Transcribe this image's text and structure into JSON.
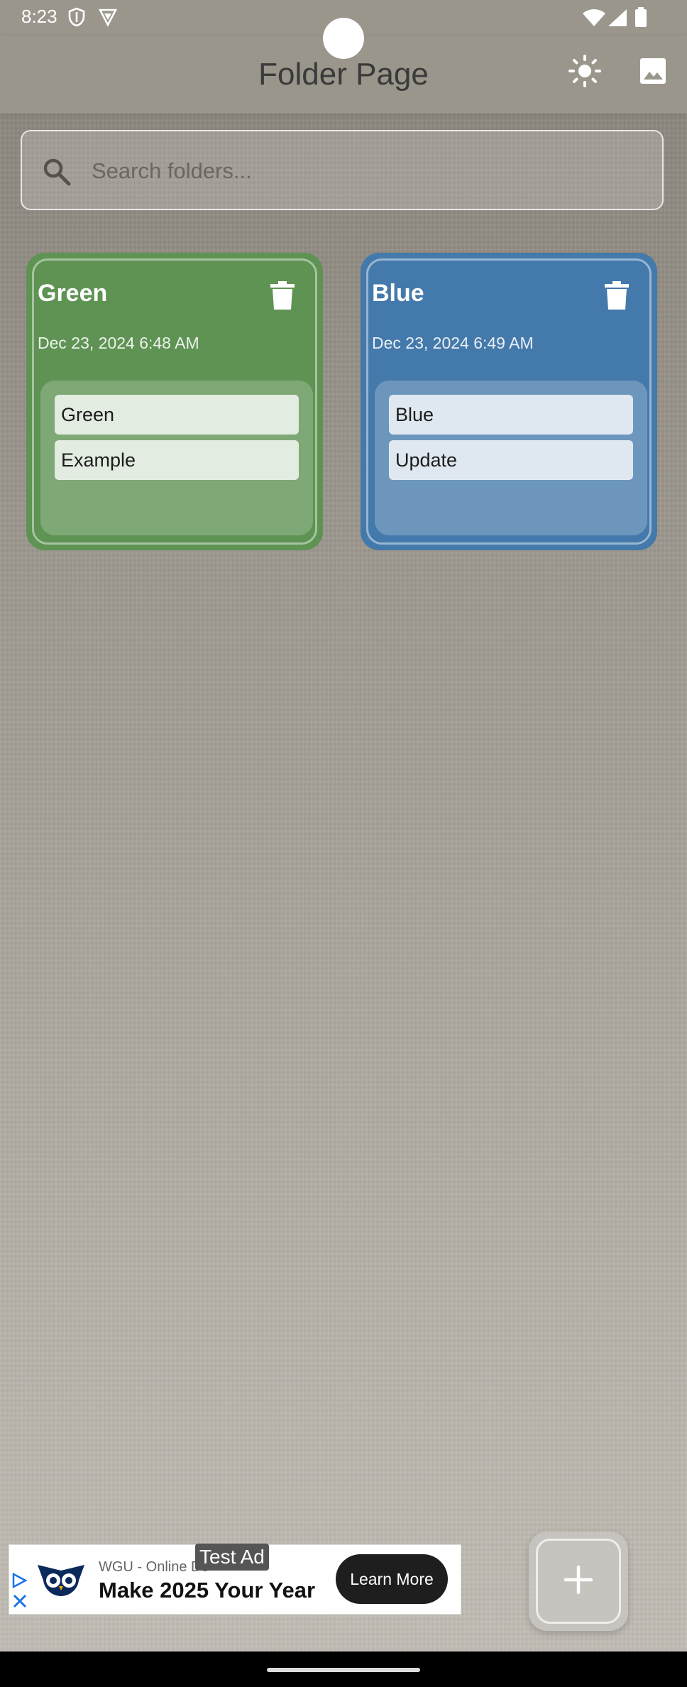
{
  "status_bar": {
    "time": "8:23",
    "left_icons": [
      "shield-icon",
      "vpn-icon"
    ],
    "right_icons": [
      "wifi-icon",
      "cell-signal-icon",
      "battery-icon"
    ]
  },
  "app_bar": {
    "title": "Folder Page",
    "actions": [
      "brightness-icon",
      "image-icon"
    ]
  },
  "search": {
    "placeholder": "Search folders..."
  },
  "folders": [
    {
      "title": "Green",
      "date": "Dec 23, 2024 6:48 AM",
      "color": "#5e9353",
      "notes": [
        "Green",
        "Example"
      ]
    },
    {
      "title": "Blue",
      "date": "Dec 23, 2024 6:49 AM",
      "color": "#4479ab",
      "notes": [
        "Blue",
        "Update"
      ]
    }
  ],
  "ad": {
    "tag": "Test Ad",
    "source": "WGU - Online De",
    "headline": "Make 2025 Your Year",
    "cta": "Learn More"
  },
  "fab": {
    "icon": "plus-icon"
  }
}
